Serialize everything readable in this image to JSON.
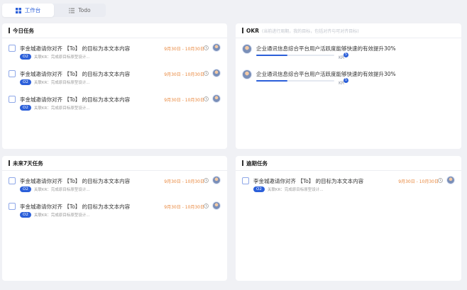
{
  "tabs": [
    {
      "label": "工作台",
      "icon": "grid-icon",
      "active": true
    },
    {
      "label": "Todo",
      "icon": "list-icon",
      "active": false
    }
  ],
  "colors": {
    "accent": "#2b5fd9",
    "date": "#e8853a",
    "background": "#f0f1f5"
  },
  "today": {
    "title": "今日任务",
    "tasks": [
      {
        "title": "李金城邀请你对齐 【To】 的目标为本文本内容",
        "badge": "O2",
        "relation": "关联KR：完成原目标原型设计...",
        "date": "9月30日 - 10月30日"
      },
      {
        "title": "李金城邀请你对齐 【To】 的目标为本文本内容",
        "badge": "O2",
        "relation": "关联KR：完成原目标原型设计...",
        "date": "9月30日 - 10月30日"
      },
      {
        "title": "李金城邀请你对齐 【To】 的目标为本文本内容",
        "badge": "O2",
        "relation": "关联KR：完成原目标原型设计...",
        "date": "9月30日 - 10月30日"
      }
    ]
  },
  "okr": {
    "title": "OKR",
    "hint": "(当前进行周期，我的目标，包括对齐与可对齐目标)",
    "items": [
      {
        "title": "企业通讯信息综合平台用户活跃度能够快速的有效提升30%",
        "progress": 0.4,
        "kr_label": "KR",
        "kr_count": "5"
      },
      {
        "title": "企业通讯信息综合平台用户活跃度能够快速的有效提升30%",
        "progress": 0.4,
        "kr_label": "KR",
        "kr_count": "5"
      }
    ]
  },
  "week": {
    "title": "未来7天任务",
    "tasks": [
      {
        "title": "李金城邀请你对齐 【To】 的目标为本文本内容",
        "badge": "O2",
        "relation": "关联KR：完成原目标原型设计...",
        "date": "9月30日 - 10月30日"
      },
      {
        "title": "李金城邀请你对齐 【To】 的目标为本文本内容",
        "badge": "O2",
        "relation": "关联KR：完成原目标原型设计...",
        "date": "9月30日 - 10月30日"
      }
    ]
  },
  "overdue": {
    "title": "逾期任务",
    "tasks": [
      {
        "title": "李金城邀请你对齐 【To】 的目标为本文本内容",
        "badge": "O2",
        "relation": "关联KR：完成原目标原型设计...",
        "date": "9月30日 - 10月30日"
      }
    ]
  }
}
